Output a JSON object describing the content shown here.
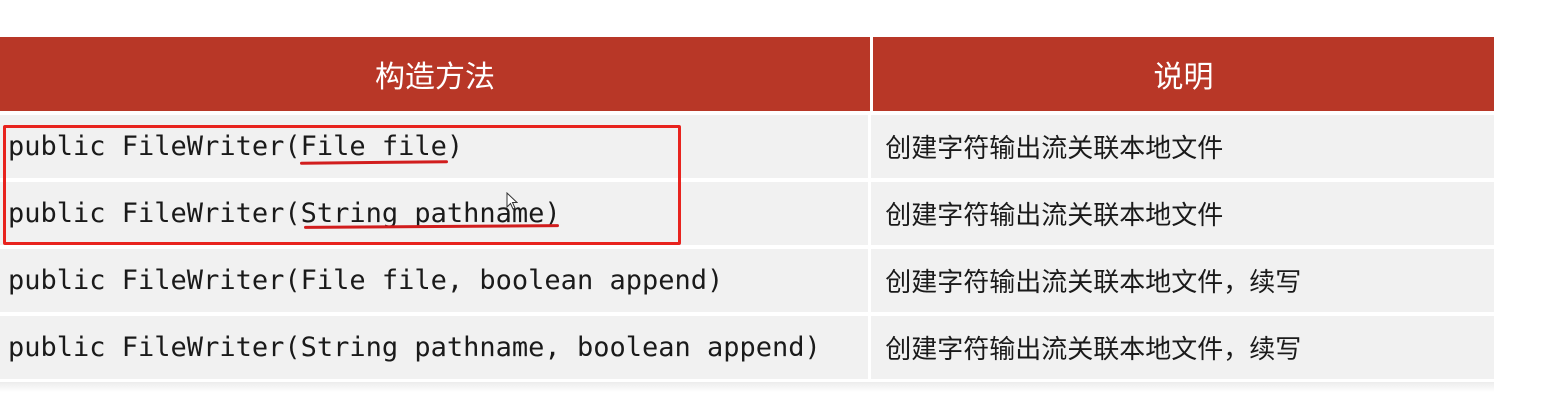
{
  "table": {
    "headers": [
      "构造方法",
      "说明"
    ],
    "rows": [
      {
        "method": "public FileWriter(File file)",
        "description": "创建字符输出流关联本地文件"
      },
      {
        "method": "public FileWriter(String pathname)",
        "description": "创建字符输出流关联本地文件"
      },
      {
        "method": "public FileWriter(File file, boolean append)",
        "description": "创建字符输出流关联本地文件，续写"
      },
      {
        "method": "public FileWriter(String pathname, boolean append)",
        "description": "创建字符输出流关联本地文件，续写"
      }
    ]
  },
  "colors": {
    "header_bg": "#b83727",
    "header_text": "#ffffff",
    "row_bg": "#f1f1f1",
    "annotation": "#e8231e"
  },
  "icons": {
    "cursor": "mouse-pointer-icon"
  }
}
